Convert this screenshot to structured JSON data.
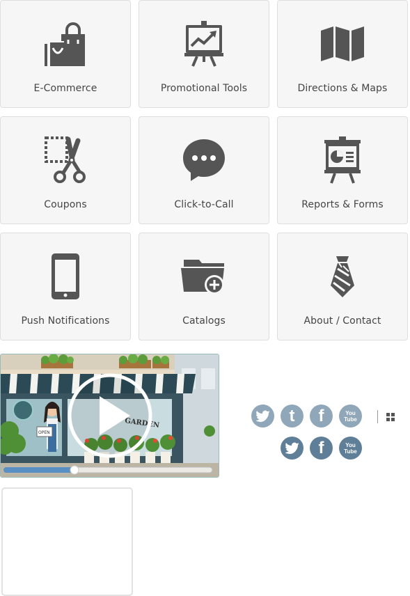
{
  "tiles": [
    {
      "label": "E-Commerce",
      "icon": "shopping-bag-icon"
    },
    {
      "label": "Promotional Tools",
      "icon": "presentation-chart-icon"
    },
    {
      "label": "Directions & Maps",
      "icon": "map-icon"
    },
    {
      "label": "Coupons",
      "icon": "scissors-coupon-icon"
    },
    {
      "label": "Click-to-Call",
      "icon": "chat-bubble-icon"
    },
    {
      "label": "Reports & Forms",
      "icon": "pie-chart-board-icon"
    },
    {
      "label": "Push Notifications",
      "icon": "smartphone-icon"
    },
    {
      "label": "Catalogs",
      "icon": "folder-add-icon"
    },
    {
      "label": "About / Contact",
      "icon": "necktie-icon"
    }
  ],
  "video": {
    "sign_text": "GARDEN",
    "progress": 0.34,
    "play_icon": "play-icon"
  },
  "social": {
    "row1": [
      {
        "icon": "twitter-bird-icon",
        "text": ""
      },
      {
        "icon": "twitter-t-icon",
        "text": "t"
      },
      {
        "icon": "facebook-icon",
        "text": "f"
      },
      {
        "icon": "youtube-icon",
        "text": "You Tube"
      }
    ],
    "row2": [
      {
        "icon": "twitter-bird-icon",
        "text": ""
      },
      {
        "icon": "facebook-icon",
        "text": "f"
      },
      {
        "icon": "youtube-icon",
        "text": "You Tube"
      }
    ]
  },
  "colors": {
    "icon": "#555555",
    "social_light": "#8fa7b9",
    "social_dark": "#5f7f99"
  }
}
